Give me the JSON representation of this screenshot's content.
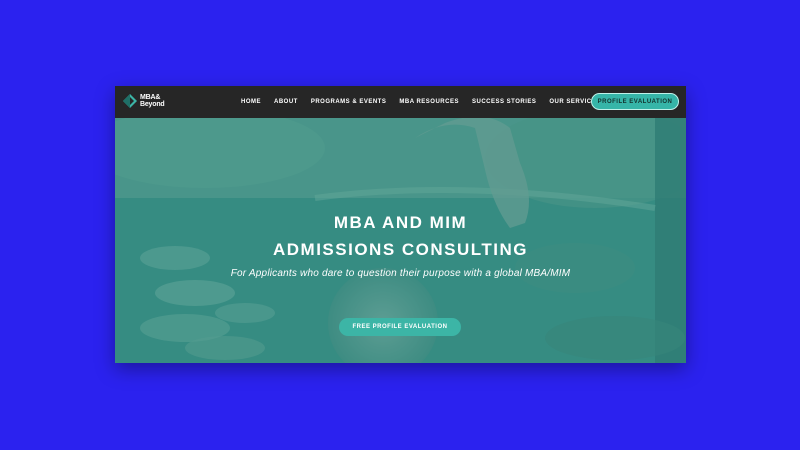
{
  "colors": {
    "page_background": "#2b22ef",
    "navbar": "#262626",
    "accent": "#3cb5a6",
    "hero_overlay": "#2f8f86"
  },
  "logo": {
    "line1": "MBA&",
    "line2": "Beyond",
    "icon": "diamond-logo-icon"
  },
  "nav": {
    "items": [
      {
        "label": "HOME"
      },
      {
        "label": "ABOUT"
      },
      {
        "label": "PROGRAMS & EVENTS"
      },
      {
        "label": "MBA RESOURCES"
      },
      {
        "label": "SUCCESS STORIES"
      },
      {
        "label": "OUR SERVICES"
      }
    ],
    "cta_label": "PROFILE EVALUATION"
  },
  "hero": {
    "title_line1": "MBA AND MIM",
    "title_line2": "ADMISSIONS CONSULTING",
    "subtitle": "For Applicants who dare to question their purpose with a global MBA/MIM",
    "cta_label": "FREE PROFILE EVALUATION",
    "background_image": "hand-on-globe-photo"
  }
}
